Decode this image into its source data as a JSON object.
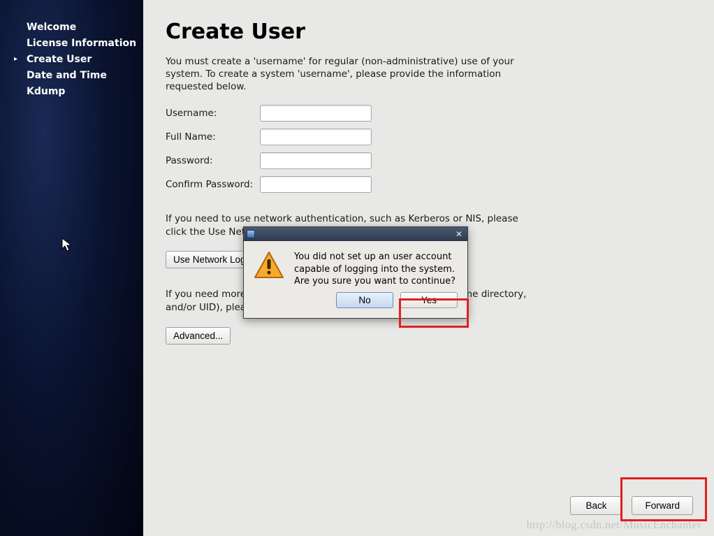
{
  "sidebar": {
    "items": [
      {
        "label": "Welcome"
      },
      {
        "label": "License Information"
      },
      {
        "label": "Create User",
        "active": true
      },
      {
        "label": "Date and Time"
      },
      {
        "label": "Kdump"
      }
    ]
  },
  "page": {
    "title": "Create User",
    "intro": "You must create a 'username' for regular (non-administrative) use of your system.  To create a system 'username', please provide the information requested below.",
    "fields": {
      "username_label": "Username:",
      "fullname_label": "Full Name:",
      "password_label": "Password:",
      "confirm_label": "Confirm Password:"
    },
    "network_info": "If you need to use network authentication, such as Kerberos or NIS, please click the Use Network Login button.",
    "network_button": "Use Network Login...",
    "advanced_info": "If you need more control when creating the user (specifying home directory, and/or UID), please click the Advanced button.",
    "advanced_button": "Advanced...",
    "nav": {
      "back": "Back",
      "forward": "Forward"
    }
  },
  "dialog": {
    "message": "You did not set up an user account capable of logging into the system. Are you sure you want to continue?",
    "no": "No",
    "yes": "Yes"
  },
  "watermark": "http://blog.csdn.net/MusicEnchanter"
}
